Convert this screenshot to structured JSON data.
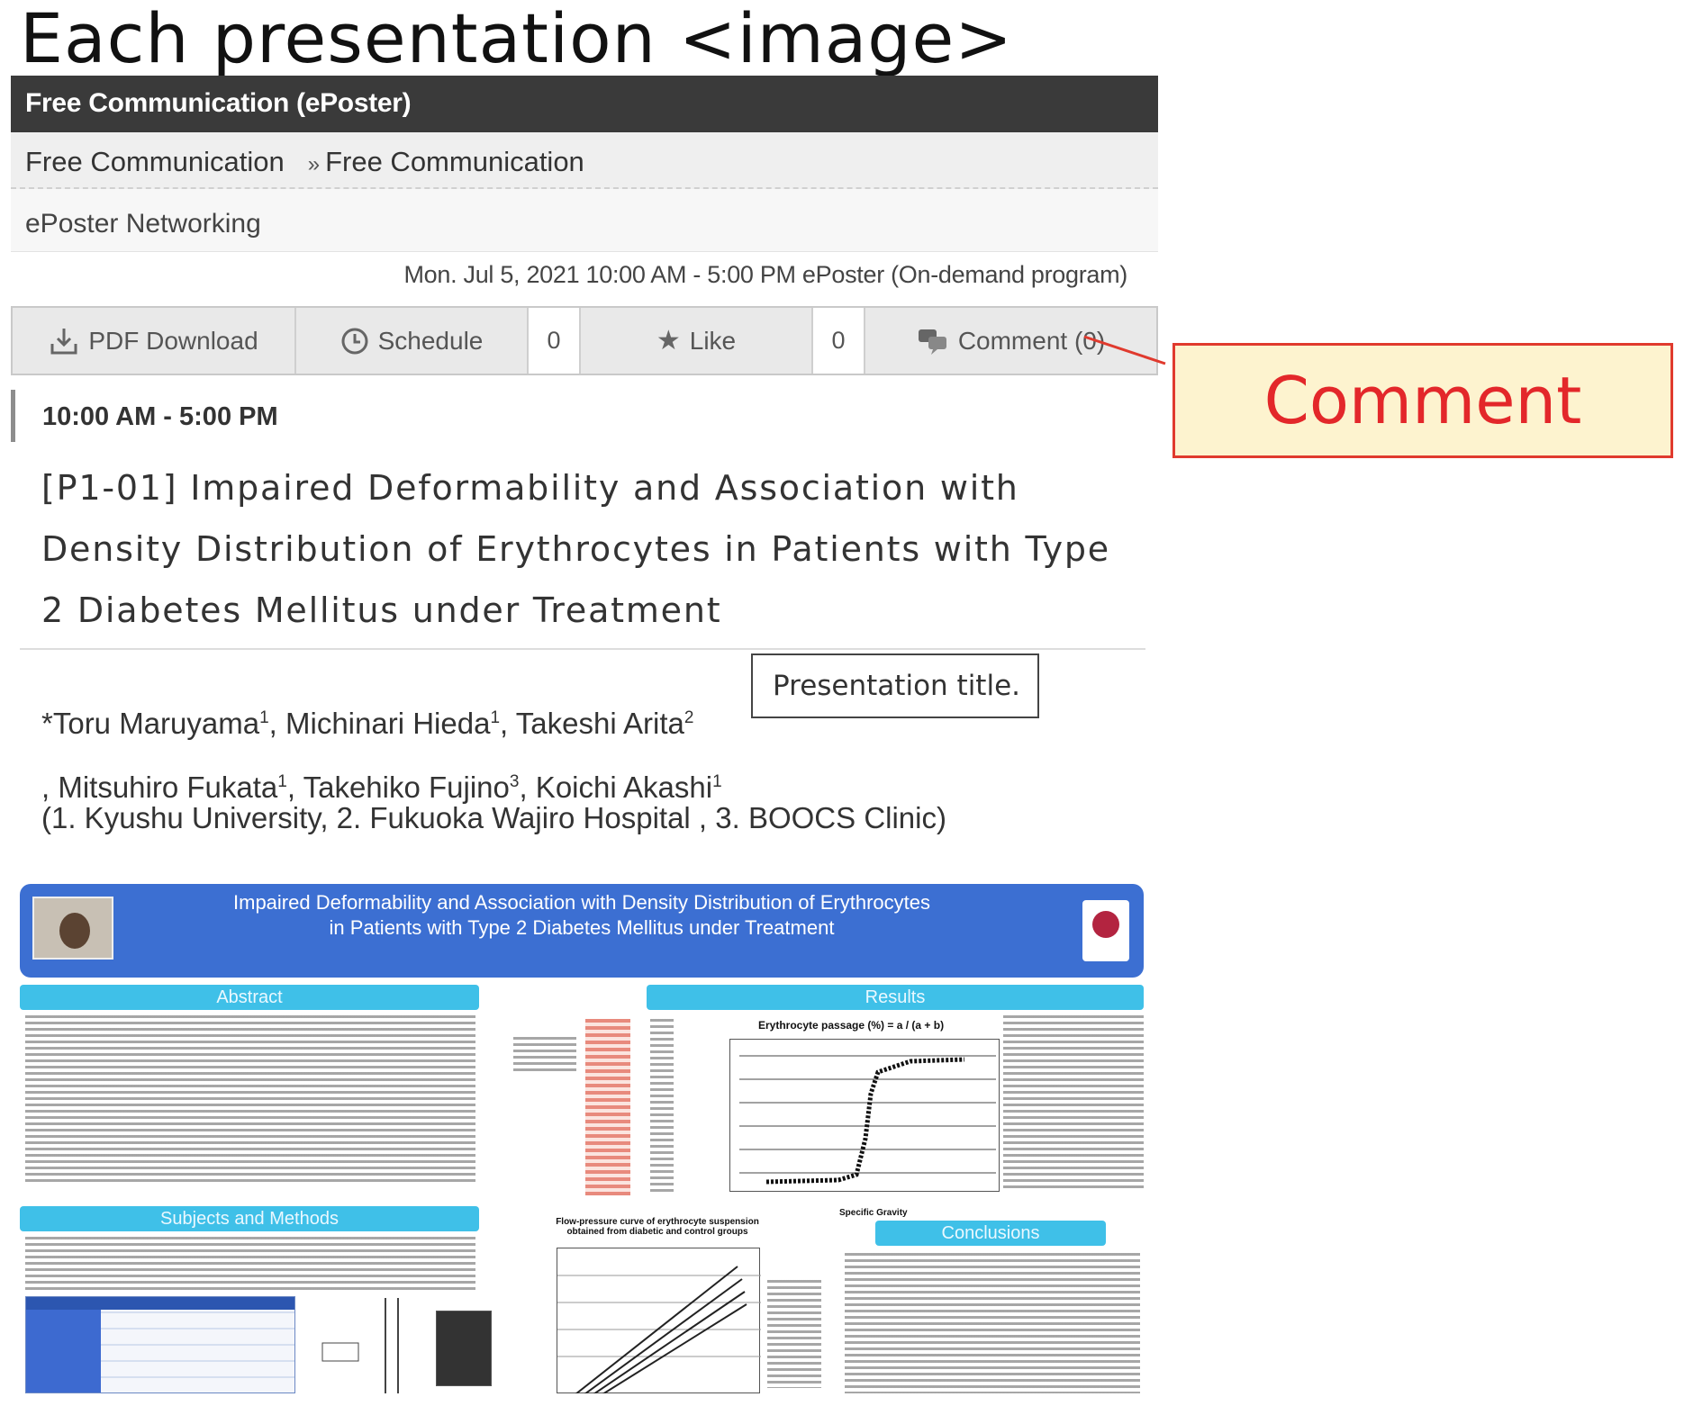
{
  "heading": "Each presentation <image>",
  "session_bar": "Free Communication (ePoster)",
  "breadcrumb": {
    "first": "Free Communication",
    "separator": "»",
    "second": "Free Communication"
  },
  "networking": "ePoster Networking",
  "datetime": "Mon. Jul 5, 2021 10:00 AM - 5:00 PM ePoster (On-demand program)",
  "actions": {
    "pdf": "PDF Download",
    "schedule": "Schedule",
    "schedule_count": "0",
    "like": "Like",
    "like_count": "0",
    "comment": "Comment (0)"
  },
  "time": "10:00 AM - 5:00 PM",
  "title_lines": [
    "[P1-01] Impaired Deformability and Association with",
    "Density Distribution of Erythrocytes in Patients with Type",
    "2 Diabetes Mellitus under Treatment"
  ],
  "authors": [
    {
      "name": "*Toru Maruyama",
      "sup": "1"
    },
    {
      "name": ", Michinari Hieda",
      "sup": "1"
    },
    {
      "name": ", Takeshi Arita",
      "sup": "2"
    },
    {
      "name": ", Mitsuhiro Fukata",
      "sup": "1"
    },
    {
      "name": ", Takehiko Fujino",
      "sup": "3"
    },
    {
      "name": ", Koichi Akashi",
      "sup": "1"
    }
  ],
  "affiliations": "(1. Kyushu University, 2. Fukuoka Wajiro Hospital , 3. BOOCS Clinic)",
  "tooltip": "Presentation title.",
  "callout": "Comment",
  "poster": {
    "title1": "Impaired Deformability and Association with Density Distribution of Erythrocytes",
    "title2": "in Patients with Type 2 Diabetes Mellitus under Treatment",
    "sections": {
      "abstract": "Abstract",
      "results": "Results",
      "subjects": "Subjects and Methods",
      "conclusions": "Conclusions"
    },
    "chart1_title": "Erythrocyte passage (%) = a / (a + b)",
    "chart1_xlabel": "Specific Gravity",
    "chart2_title": "Flow-pressure curve of erythrocyte suspension obtained from diabetic and control groups"
  },
  "colors": {
    "accent_red": "#e3272a",
    "callout_bg": "#fdf3cf",
    "topbar": "#3a3a3a",
    "poster_blue": "#3c6fd2",
    "poster_cyan": "#3fc0e8"
  }
}
